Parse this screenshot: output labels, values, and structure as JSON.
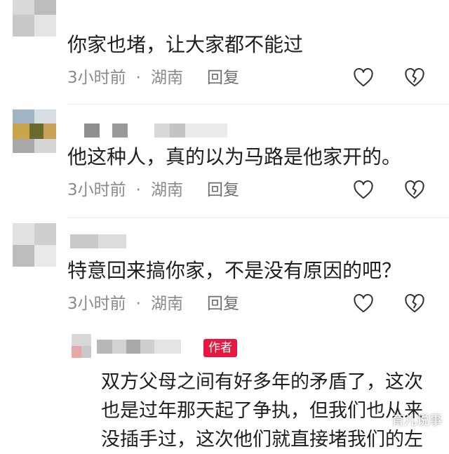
{
  "comments": [
    {
      "text": "你家也堵，让大家都不能过",
      "time": "3小时前",
      "separator": "·",
      "region": "湖南",
      "reply_label": "回复"
    },
    {
      "text": "他这种人，真的以为马路是他家开的。",
      "time": "3小时前",
      "separator": "·",
      "region": "湖南",
      "reply_label": "回复"
    },
    {
      "text": "特意回来搞你家，不是没有原因的吧？",
      "time": "3小时前",
      "separator": "·",
      "region": "湖南",
      "reply_label": "回复"
    }
  ],
  "author_reply": {
    "badge": "作者",
    "lines": [
      "双方父母之间有好多年的矛盾了，这次",
      "也是过年那天起了争执，但我们也从来",
      "没插手过，这次他们就直接堵我们的左"
    ]
  },
  "watermark": "育儿说事",
  "colors": {
    "badge": "#e8173f",
    "meta": "#8a8a8a",
    "text": "#1f1f1f"
  },
  "icons": {
    "like": "heart-outline-icon",
    "dislike": "broken-heart-icon"
  }
}
